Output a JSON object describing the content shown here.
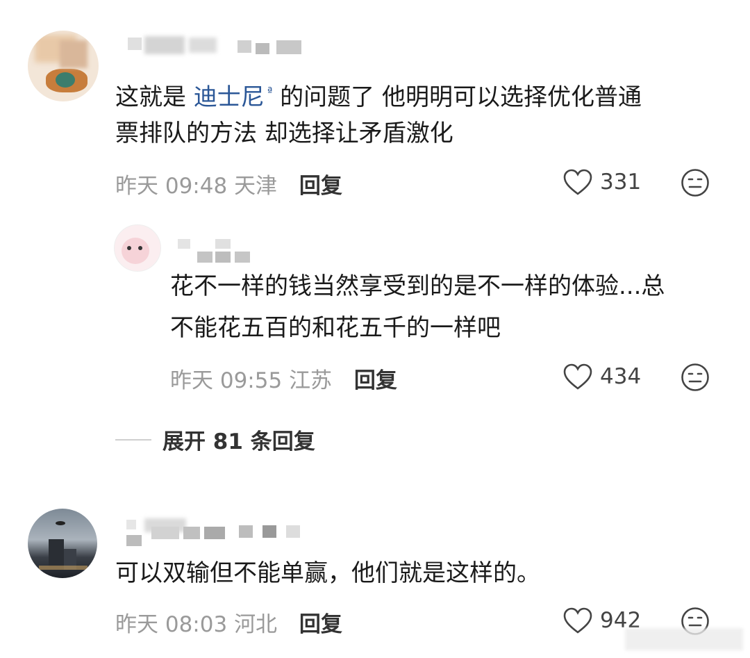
{
  "comments": [
    {
      "username": "...可我的...",
      "content_prefix": "这就是 ",
      "link_text": "迪士尼",
      "link_mark": "ª",
      "content_rest_line1": " 的问题了 他明明可以选择优化普通",
      "content_line2": "票排队的方法 却选择让矛盾激化",
      "time": "昨天 09:48",
      "location": "天津",
      "reply_label": "回复",
      "likes": "331"
    },
    {
      "username": "...",
      "content_line1": "花不一样的钱当然享受到的是不一样的体验...总",
      "content_line2": "不能花五百的和花五千的一样吧",
      "time": "昨天 09:55",
      "location": "江苏",
      "reply_label": "回复",
      "likes": "434"
    },
    {
      "username": "...",
      "content_line1": "可以双输但不能单赢，他们就是这样的。",
      "time": "昨天 08:03",
      "location": "河北",
      "reply_label": "回复",
      "likes": "942"
    }
  ],
  "expand_replies": "展开 81 条回复",
  "icons": {
    "like": "heart-outline-icon",
    "dislike": "neutral-face-icon"
  },
  "colors": {
    "link": "#2b5797",
    "meta": "#9a9a9a"
  }
}
